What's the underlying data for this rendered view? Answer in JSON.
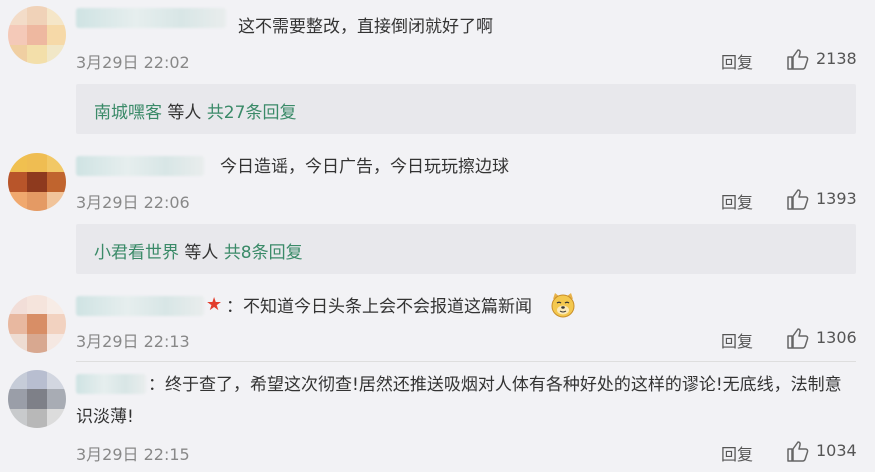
{
  "comments": [
    {
      "text": "这不需要整改，直接倒闭就好了啊",
      "time": "3月29日 22:02",
      "reply_label": "回复",
      "likes": "2138",
      "thread": {
        "name": "南城嘿客",
        "mid": "等人",
        "count": "共27条回复"
      }
    },
    {
      "text": "今日造谣，今日广告，今日玩玩擦边球",
      "time": "3月29日 22:06",
      "reply_label": "回复",
      "likes": "1393",
      "thread": {
        "name": "小君看世界",
        "mid": "等人",
        "count": "共8条回复"
      }
    },
    {
      "text": "：不知道今日头条上会不会报道这篇新闻",
      "time": "3月29日 22:13",
      "reply_label": "回复",
      "likes": "1306"
    },
    {
      "text": "：终于查了，希望这次彻查!居然还推送吸烟对人体有各种好处的这样的谬论!无底线，法制意识淡薄!",
      "time": "3月29日 22:15",
      "reply_label": "回复",
      "likes": "1034"
    }
  ],
  "icons": {
    "like": "thumbs-up-icon",
    "badge": "red-star-icon",
    "emoji": "doge-emoji-icon"
  },
  "colors": {
    "background": "#f2f2f5",
    "thread_box": "#e8e8ec",
    "link": "#3a8a68",
    "star": "#e23c2c"
  }
}
